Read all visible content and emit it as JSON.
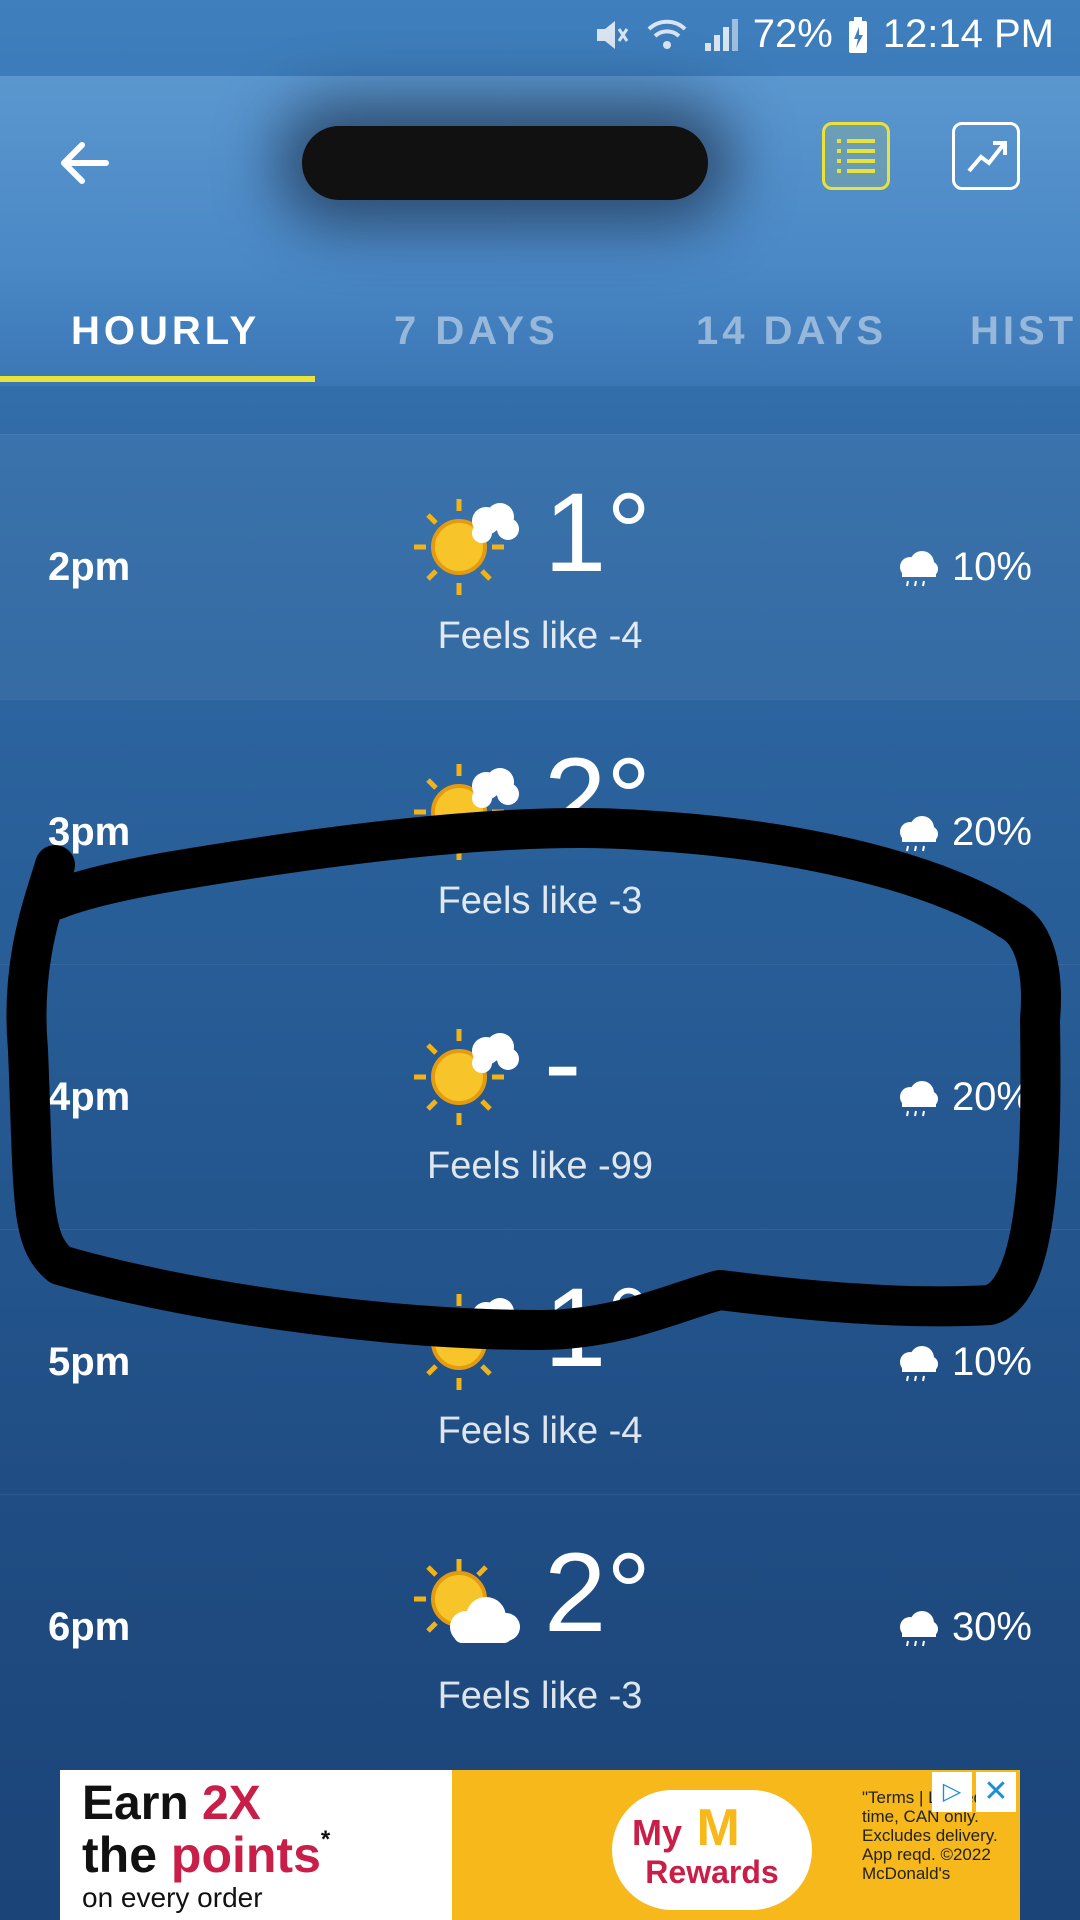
{
  "status_bar": {
    "battery": "72%",
    "time": "12:14 PM",
    "icons": [
      "mute-icon",
      "wifi-icon",
      "signal-icon",
      "battery-icon"
    ]
  },
  "header": {
    "title": "",
    "actions": [
      "list-view-icon",
      "chart-view-icon"
    ],
    "accent_color": "#e9e23b"
  },
  "tabs": [
    {
      "label": "HOURLY",
      "active": true
    },
    {
      "label": "7 DAYS",
      "active": false
    },
    {
      "label": "14 DAYS",
      "active": false
    },
    {
      "label": "HIST",
      "active": false
    }
  ],
  "hourly": [
    {
      "time": "2pm",
      "icon": "partly-sunny-icon",
      "temp": "1°",
      "feels": "Feels like -4",
      "precip": "10%"
    },
    {
      "time": "3pm",
      "icon": "partly-sunny-icon",
      "temp": "2°",
      "feels": "Feels like -3",
      "precip": "20%"
    },
    {
      "time": "4pm",
      "icon": "partly-sunny-icon",
      "temp": "-",
      "feels": "Feels like -99",
      "precip": "20%"
    },
    {
      "time": "5pm",
      "icon": "partly-sunny-icon",
      "temp": "1°",
      "feels": "Feels like -4",
      "precip": "10%"
    },
    {
      "time": "6pm",
      "icon": "sun-behind-cloud-icon",
      "temp": "2°",
      "feels": "Feels like -3",
      "precip": "30%"
    }
  ],
  "ad": {
    "line1_a": "Earn ",
    "line1_b": "2X",
    "line2_a": "the ",
    "line2_b": "points",
    "line2_c": "*",
    "line3": "on every order",
    "brand_my": "My",
    "brand_rewards": "Rewards",
    "terms": "\"Terms | Limited time, CAN only. Excludes delivery. App reqd. ©2022 McDonald's",
    "close": "✕",
    "info": "▷"
  }
}
